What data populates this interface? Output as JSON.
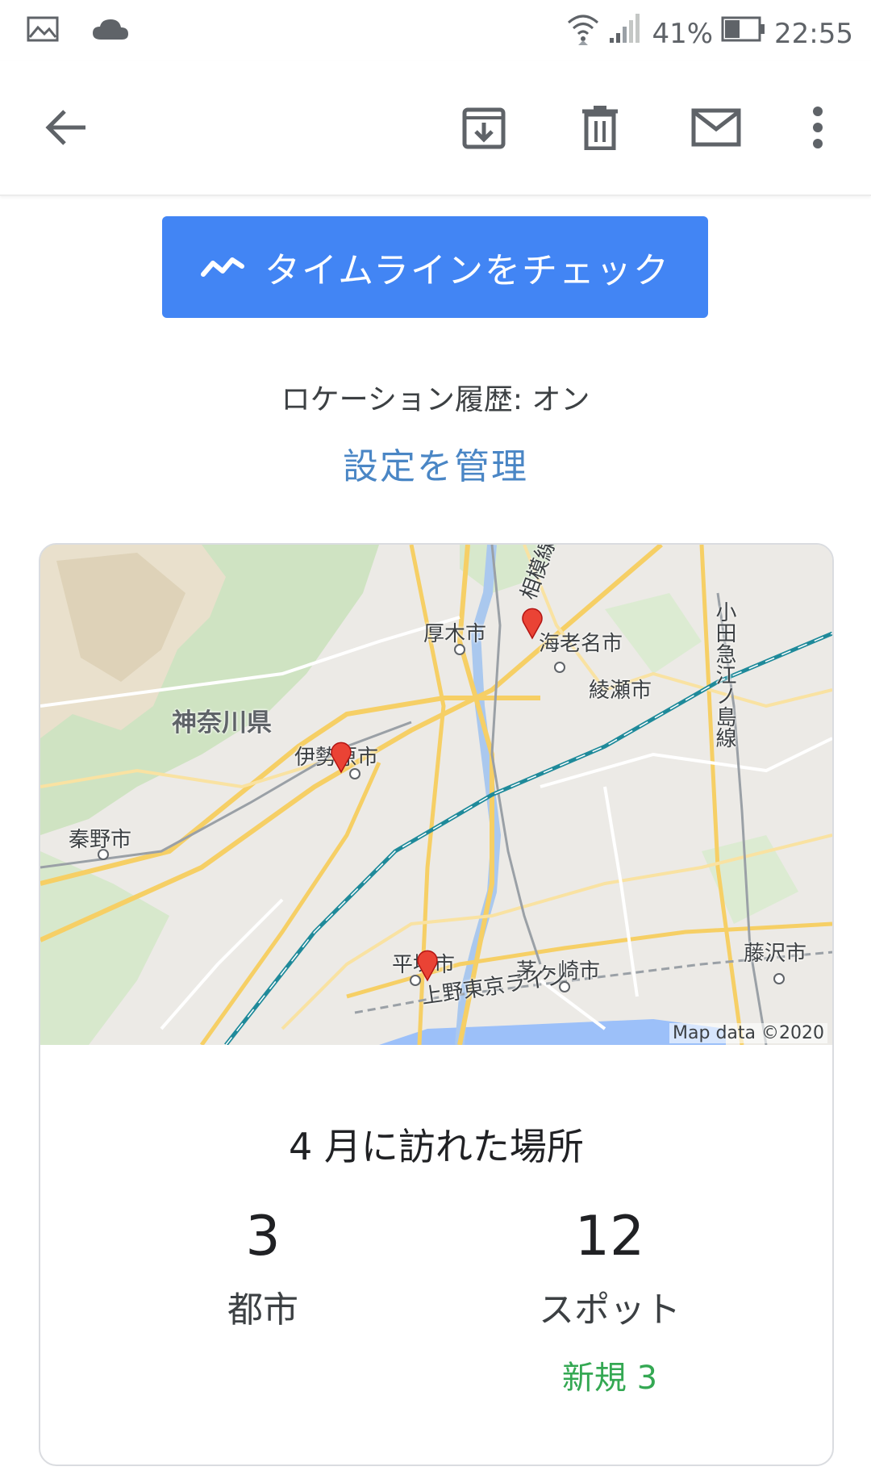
{
  "status_bar": {
    "left_icons": [
      "image-icon",
      "cloud-icon"
    ],
    "right_icons": [
      "wifi-icon",
      "signal-icon"
    ],
    "battery_percent": "41%",
    "time": "22:55"
  },
  "app_bar": {
    "icons": [
      "back-arrow-icon",
      "archive-icon",
      "delete-icon",
      "mail-icon",
      "more-vert-icon"
    ]
  },
  "email": {
    "timeline_button": "タイムラインをチェック",
    "location_history": "ロケーション履歴: オン",
    "manage_settings": "設定を管理",
    "map": {
      "labels": {
        "atsugi": "厚木市",
        "ebina": "海老名市",
        "ayase": "綾瀬市",
        "kanagawa": "神奈川県",
        "isehara": "伊勢原市",
        "hadano": "秦野市",
        "hiratsuka": "平塚市",
        "chigasaki": "茅ヶ崎市",
        "fujisawa": "藤沢市",
        "ueno_tokyo_line": "上野東京ライン",
        "sagami_line": "相模線",
        "odakyu_enoshima": "小田急江ノ島線"
      },
      "attribution": "Map data ©2020"
    },
    "summary": {
      "title": "4 月に訪れた場所",
      "cities_count": "3",
      "cities_label": "都市",
      "spots_count": "12",
      "spots_label": "スポット",
      "spots_new": "新規 3"
    }
  },
  "colors": {
    "accent": "#4285f4",
    "link": "#4a86c5",
    "new_green": "#34a853",
    "marker_red": "#ea4335"
  }
}
